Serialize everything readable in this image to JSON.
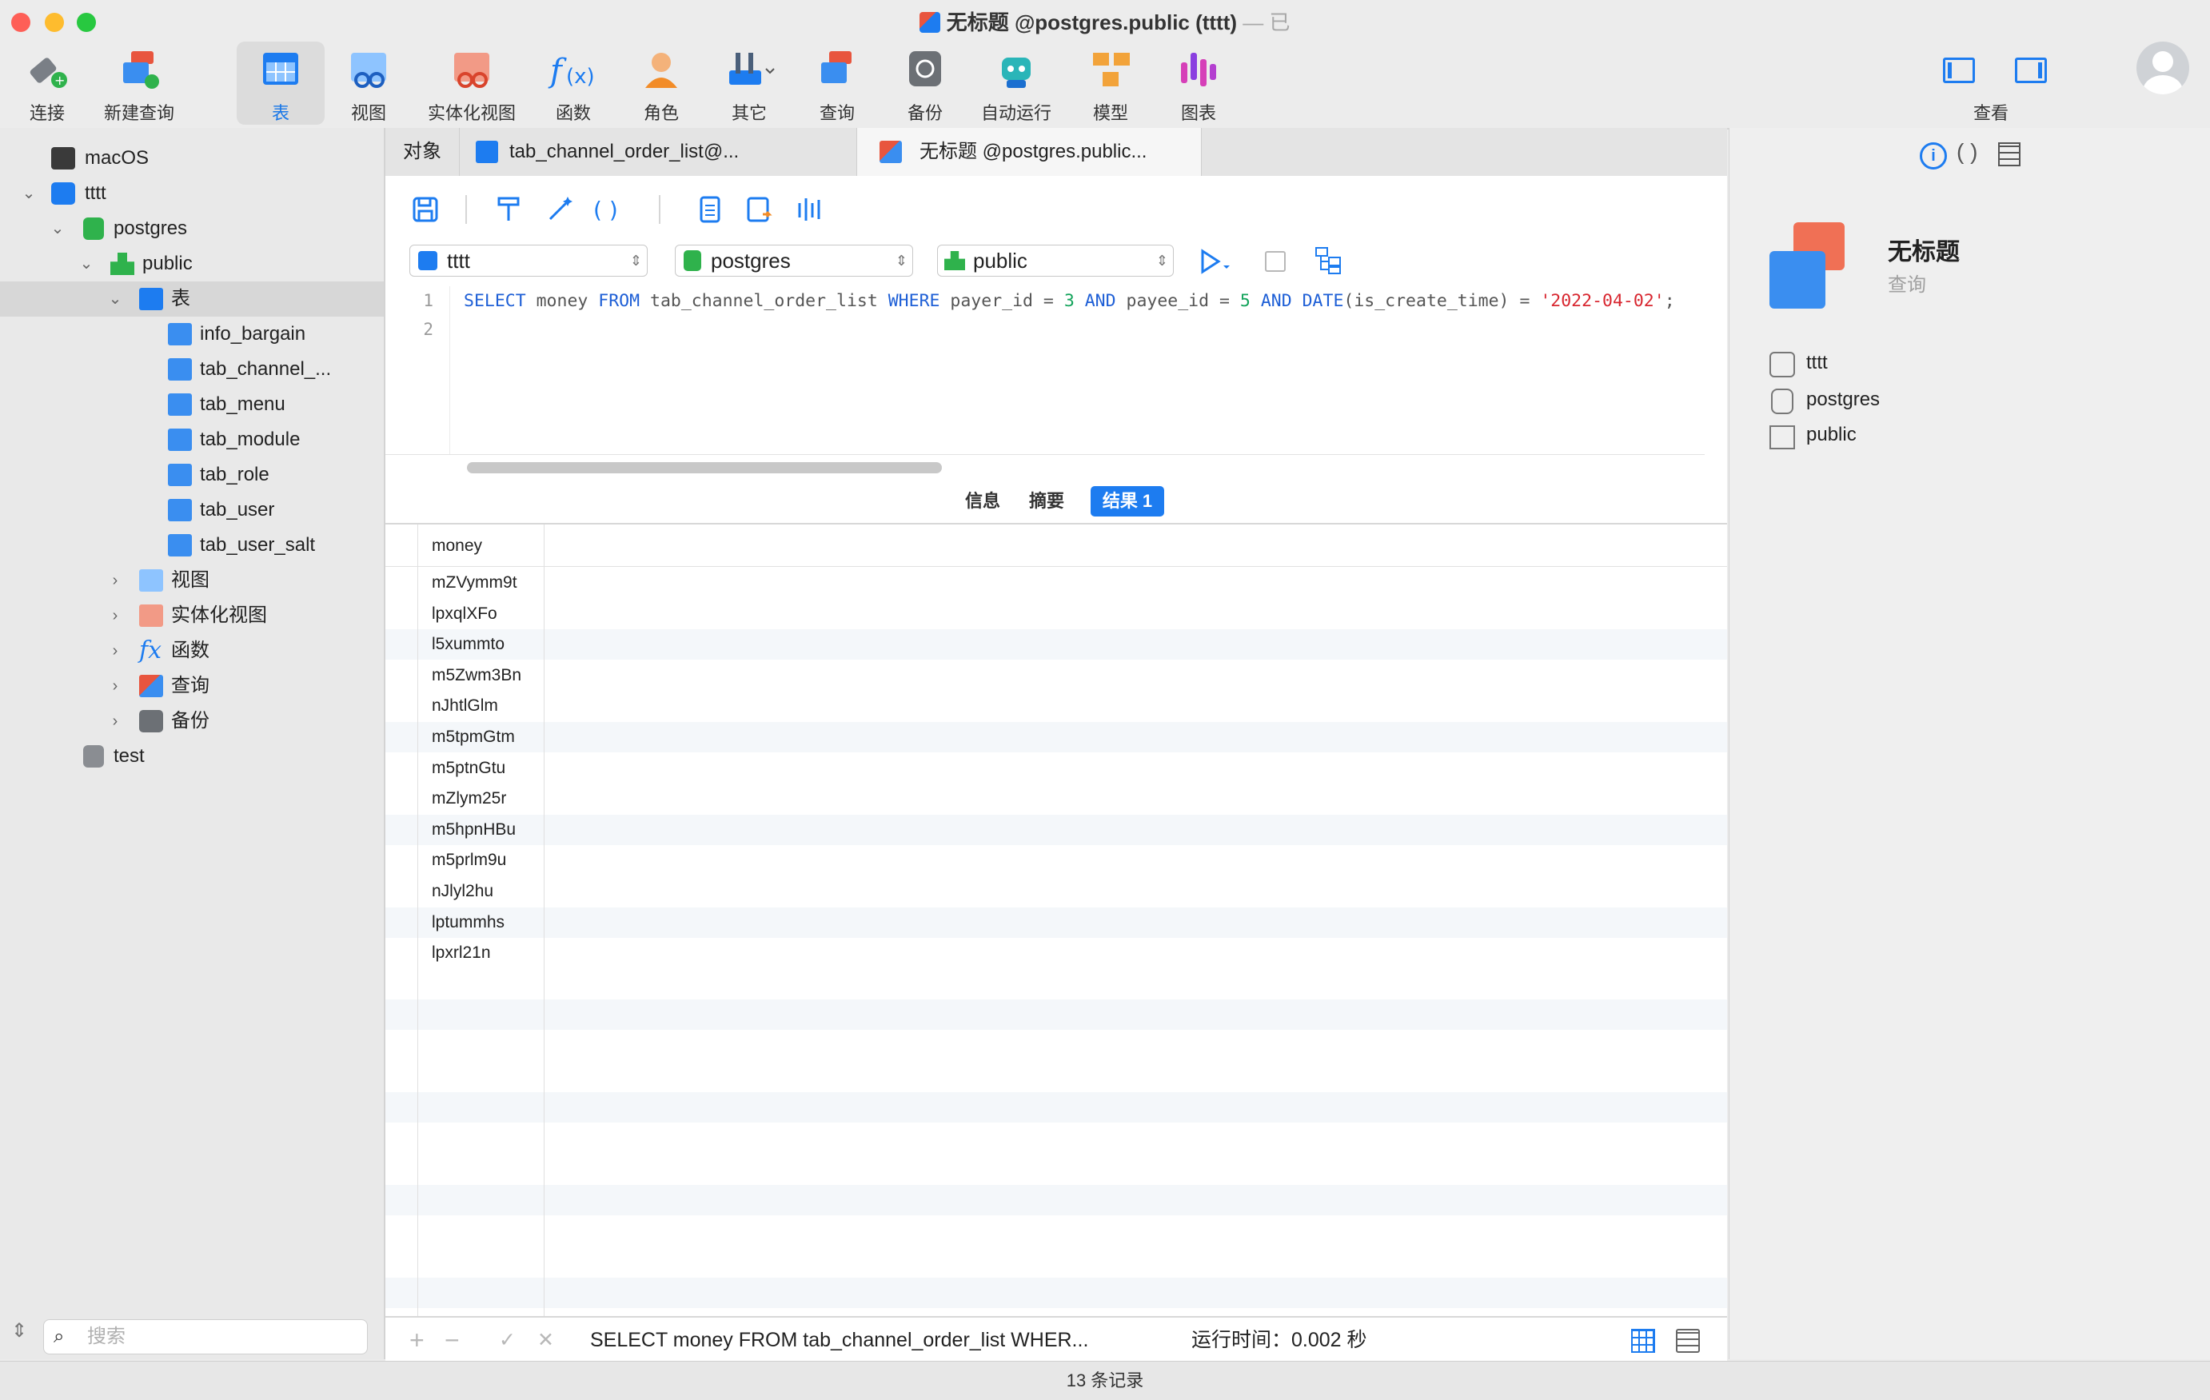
{
  "window": {
    "title": "无标题 @postgres.public (tttt)",
    "title_suffix": "— 已"
  },
  "toolbar": {
    "items": [
      {
        "label": "连接",
        "icon": "plug-icon"
      },
      {
        "label": "新建查询",
        "icon": "new-query-icon"
      },
      {
        "label": "表",
        "icon": "table-icon",
        "active": true
      },
      {
        "label": "视图",
        "icon": "view-icon"
      },
      {
        "label": "实体化视图",
        "icon": "materialized-view-icon"
      },
      {
        "label": "函数",
        "icon": "function-icon"
      },
      {
        "label": "角色",
        "icon": "user-role-icon"
      },
      {
        "label": "其它",
        "icon": "tools-icon"
      },
      {
        "label": "查询",
        "icon": "query-icon"
      },
      {
        "label": "备份",
        "icon": "backup-icon"
      },
      {
        "label": "自动运行",
        "icon": "robot-icon"
      },
      {
        "label": "模型",
        "icon": "model-icon"
      },
      {
        "label": "图表",
        "icon": "chart-icon"
      }
    ],
    "view_label": "查看"
  },
  "sidebar": {
    "tree": [
      {
        "label": "macOS"
      },
      {
        "label": "tttt"
      },
      {
        "label": "postgres"
      },
      {
        "label": "public"
      },
      {
        "label": "表"
      },
      {
        "label": "info_bargain"
      },
      {
        "label": "tab_channel_..."
      },
      {
        "label": "tab_menu"
      },
      {
        "label": "tab_module"
      },
      {
        "label": "tab_role"
      },
      {
        "label": "tab_user"
      },
      {
        "label": "tab_user_salt"
      },
      {
        "label": "视图"
      },
      {
        "label": "实体化视图"
      },
      {
        "label": "函数"
      },
      {
        "label": "查询"
      },
      {
        "label": "备份"
      },
      {
        "label": "test"
      }
    ],
    "search_placeholder": "搜索"
  },
  "tabs": [
    {
      "label": "对象"
    },
    {
      "label": "tab_channel_order_list@..."
    },
    {
      "label": "无标题 @postgres.public...",
      "active": true
    }
  ],
  "editor": {
    "connection": "tttt",
    "database": "postgres",
    "schema": "public",
    "line_numbers": [
      "1",
      "2"
    ],
    "sql_tokens": [
      {
        "t": "SELECT",
        "c": "kw"
      },
      {
        "t": " money ",
        "c": ""
      },
      {
        "t": "FROM",
        "c": "kw"
      },
      {
        "t": " tab_channel_order_list ",
        "c": ""
      },
      {
        "t": "WHERE",
        "c": "kw"
      },
      {
        "t": " payer_id = ",
        "c": ""
      },
      {
        "t": "3",
        "c": "num"
      },
      {
        "t": " ",
        "c": ""
      },
      {
        "t": "AND",
        "c": "kw"
      },
      {
        "t": " payee_id = ",
        "c": ""
      },
      {
        "t": "5",
        "c": "num"
      },
      {
        "t": " ",
        "c": ""
      },
      {
        "t": "AND",
        "c": "kw"
      },
      {
        "t": " ",
        "c": ""
      },
      {
        "t": "DATE",
        "c": "kw"
      },
      {
        "t": "(is_create_time) = ",
        "c": ""
      },
      {
        "t": "'2022-04-02'",
        "c": "str"
      },
      {
        "t": ";",
        "c": ""
      }
    ]
  },
  "results": {
    "tabs": [
      {
        "label": "信息"
      },
      {
        "label": "摘要"
      },
      {
        "label": "结果 1",
        "active": true
      }
    ],
    "column": "money",
    "rows": [
      "mZVymm9t",
      "lpxqlXFo",
      "l5xummto",
      "m5Zwm3Bn",
      "nJhtlGlm",
      "m5tpmGtm",
      "m5ptnGtu",
      "mZlym25r",
      "m5hpnHBu",
      "m5prlm9u",
      "nJlyl2hu",
      "lptummhs",
      "lpxrl21n"
    ]
  },
  "status": {
    "query_preview": "SELECT money FROM tab_channel_order_list WHER...",
    "runtime": "运行时间：0.002 秒",
    "record_count": "13 条记录"
  },
  "info_panel": {
    "title": "无标题",
    "subtitle": "查询",
    "items": [
      {
        "label": "tttt",
        "icon": "elephant-icon"
      },
      {
        "label": "postgres",
        "icon": "database-icon"
      },
      {
        "label": "public",
        "icon": "schema-icon"
      }
    ]
  },
  "colors": {
    "accent": "#1d7cf0",
    "keyword": "#1e5fd6",
    "number": "#12a35a",
    "string": "#d8262f"
  }
}
